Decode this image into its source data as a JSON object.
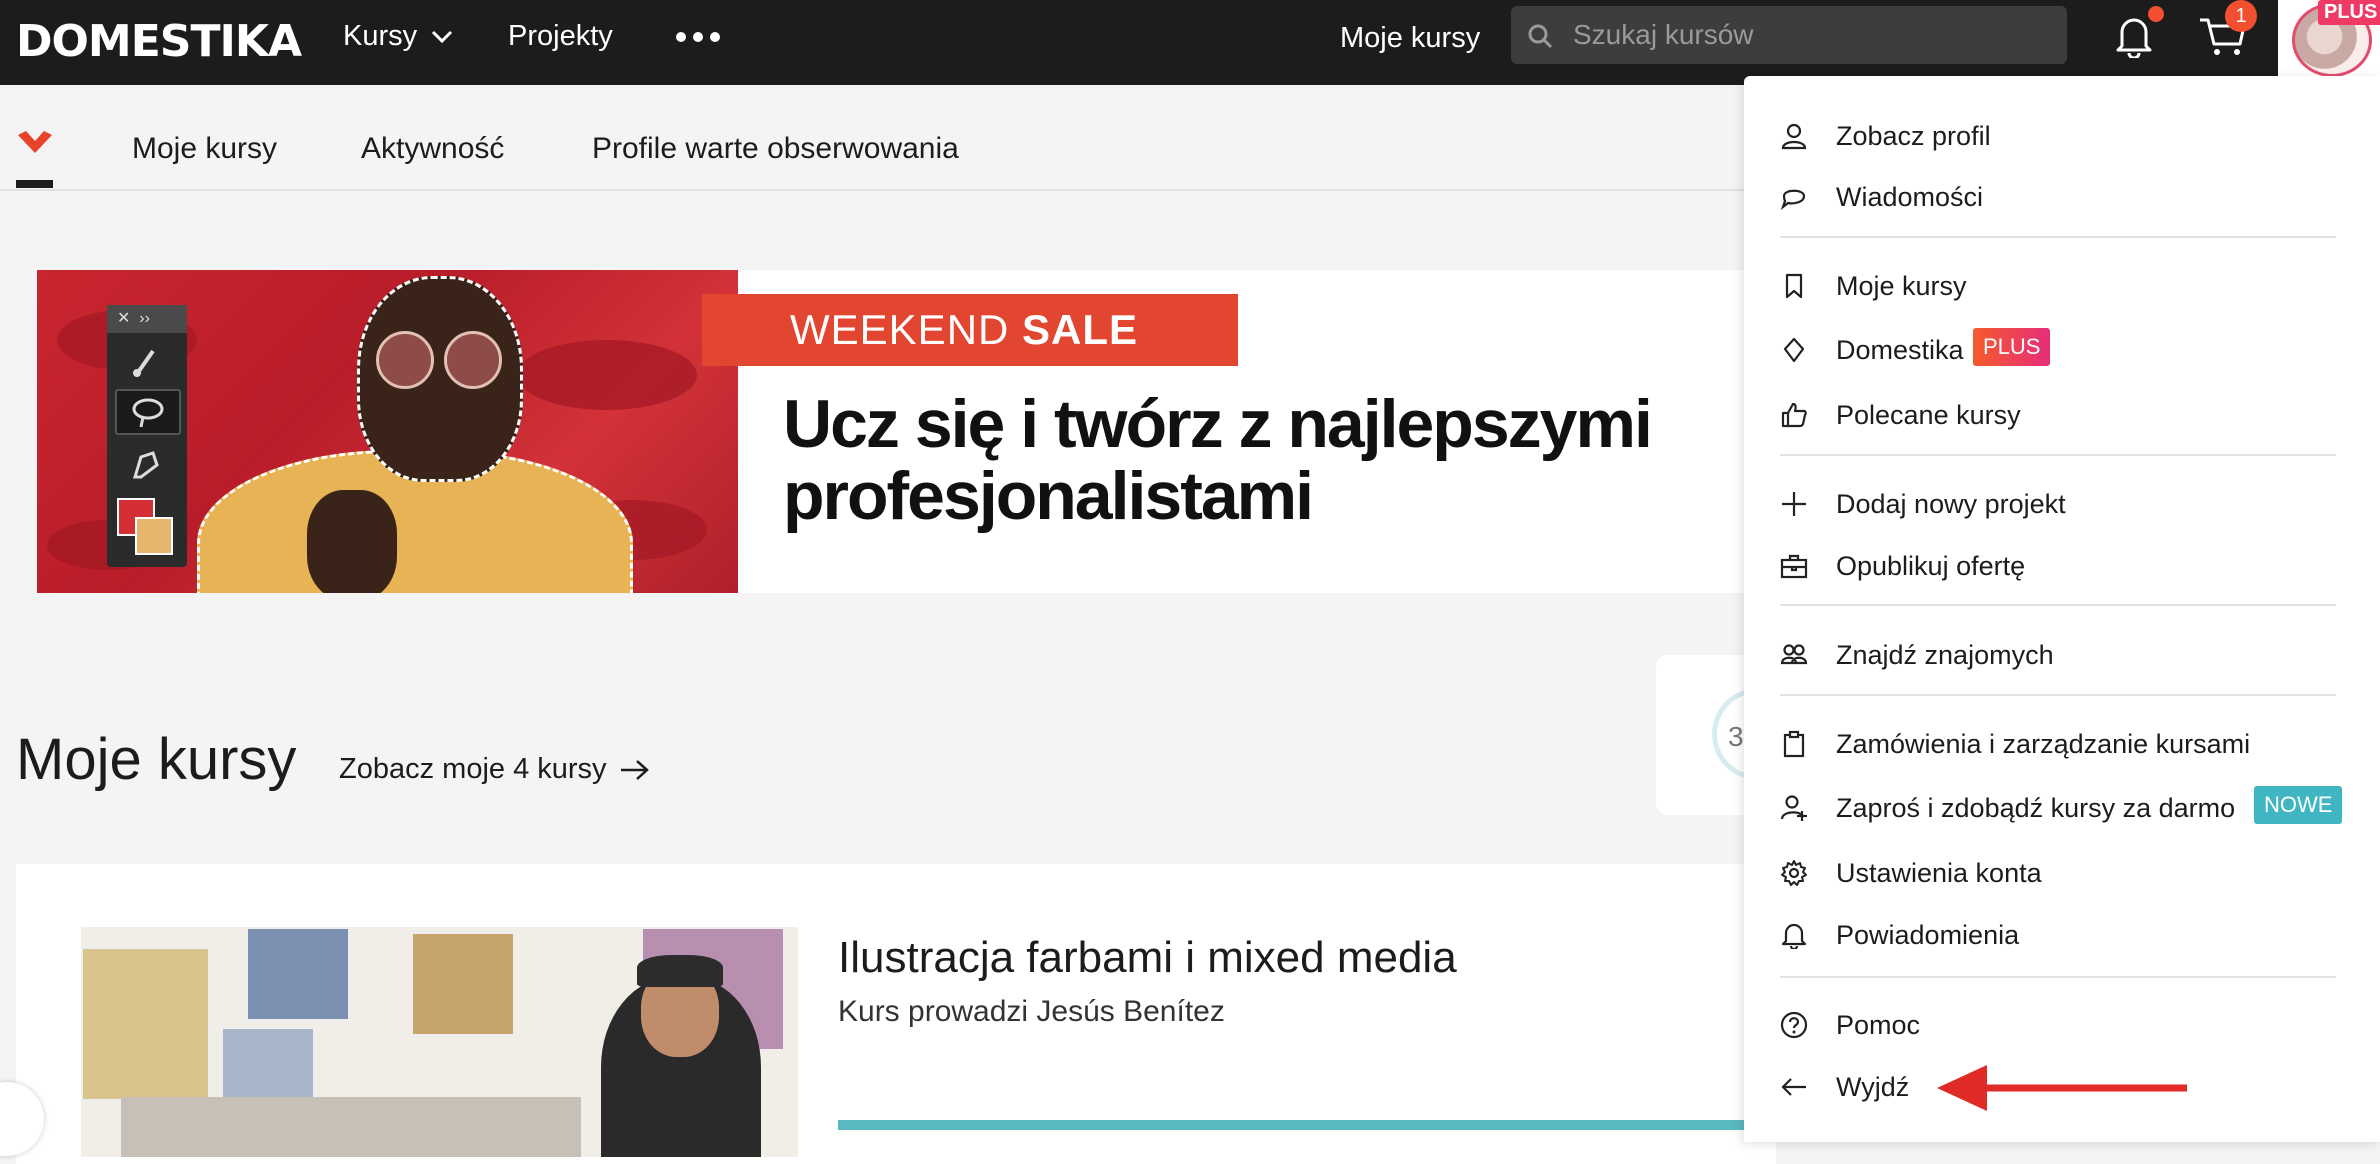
{
  "topbar": {
    "logo": "DOMESTIKA",
    "nav_kursy": "Kursy",
    "nav_projekty": "Projekty",
    "nav_moje_kursy": "Moje kursy",
    "search_placeholder": "Szukaj kursów",
    "cart_count": "1",
    "avatar_badge": "PLUS"
  },
  "subnav": {
    "items": [
      "Moje kursy",
      "Aktywność",
      "Profile warte obserwowania"
    ]
  },
  "banner": {
    "sale_light": "WEEKEND",
    "sale_bold": "SALE",
    "headline": "Ucz się i twórz z najlepszymi profesjonalistami"
  },
  "my_courses": {
    "title": "Moje kursy",
    "link": "Zobacz moje 4 kursy",
    "stats_number": "3",
    "course": {
      "title": "Ilustracja farbami i mixed media",
      "instructor": "Kurs prowadzi Jesús Benítez"
    }
  },
  "dropdown": {
    "items": [
      {
        "label": "Zobacz profil",
        "icon": "user-icon"
      },
      {
        "label": "Wiadomości",
        "icon": "chat-bubble-icon"
      },
      {
        "label": "Moje kursy",
        "icon": "bookmark-icon"
      },
      {
        "label": "Domestika",
        "icon": "diamond-icon",
        "badge": "PLUS"
      },
      {
        "label": "Polecane kursy",
        "icon": "thumbs-up-icon"
      },
      {
        "label": "Dodaj nowy projekt",
        "icon": "plus-icon"
      },
      {
        "label": "Opublikuj ofertę",
        "icon": "briefcase-icon"
      },
      {
        "label": "Znajdź znajomych",
        "icon": "users-icon"
      },
      {
        "label": "Zamówienia i zarządzanie kursami",
        "icon": "clipboard-icon"
      },
      {
        "label": "Zaproś i zdobądź kursy za darmo",
        "icon": "user-plus-icon",
        "badge": "NOWE"
      },
      {
        "label": "Ustawienia konta",
        "icon": "gear-icon"
      },
      {
        "label": "Powiadomienia",
        "icon": "bell-icon"
      },
      {
        "label": "Pomoc",
        "icon": "help-circle-icon"
      },
      {
        "label": "Wyjdź",
        "icon": "arrow-left-icon"
      }
    ]
  },
  "colors": {
    "brand": "#1c1c1c",
    "accent_red": "#f35031",
    "nowe_badge": "#3fb6c1",
    "progress": "#5ab8c0"
  }
}
